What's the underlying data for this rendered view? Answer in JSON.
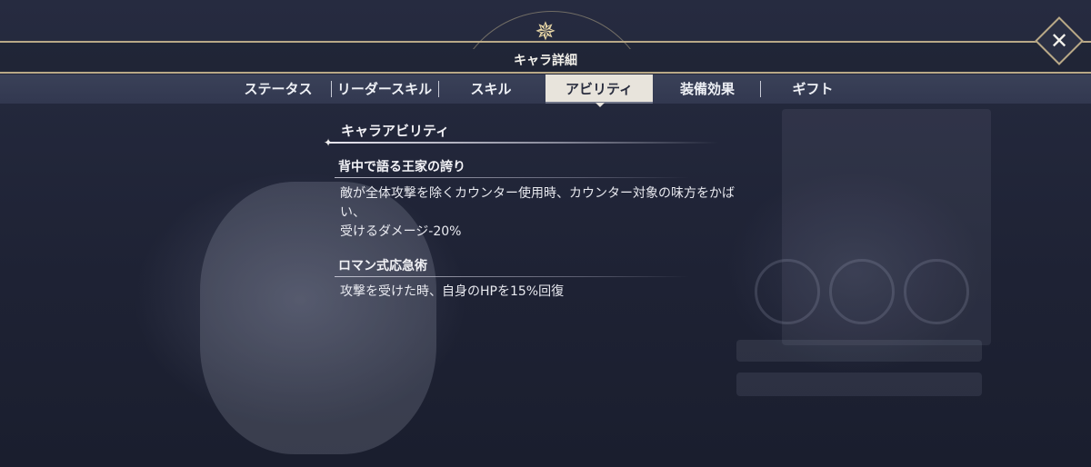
{
  "header": {
    "title": "キャラ詳細",
    "emblem_icon": "compass-star-icon",
    "close_icon": "close-x-icon"
  },
  "tabs": [
    {
      "label": "ステータス",
      "active": false
    },
    {
      "label": "リーダースキル",
      "active": false
    },
    {
      "label": "スキル",
      "active": false
    },
    {
      "label": "アビリティ",
      "active": true
    },
    {
      "label": "装備効果",
      "active": false
    },
    {
      "label": "ギフト",
      "active": false
    }
  ],
  "section": {
    "title": "キャラアビリティ"
  },
  "abilities": [
    {
      "name": "背中で語る王家の誇り",
      "desc_line1": "敵が全体攻撃を除くカウンター使用時、カウンター対象の味方をかば",
      "desc_line2": "い、",
      "desc_line3": "受けるダメージ-20%"
    },
    {
      "name": "ロマン式応急術",
      "desc_line1": "攻撃を受けた時、自身のHPを15%回復"
    }
  ],
  "colors": {
    "accent_gold": "#b9a987",
    "active_tab_bg": "#e8e4dc",
    "background": "#1f2438"
  }
}
